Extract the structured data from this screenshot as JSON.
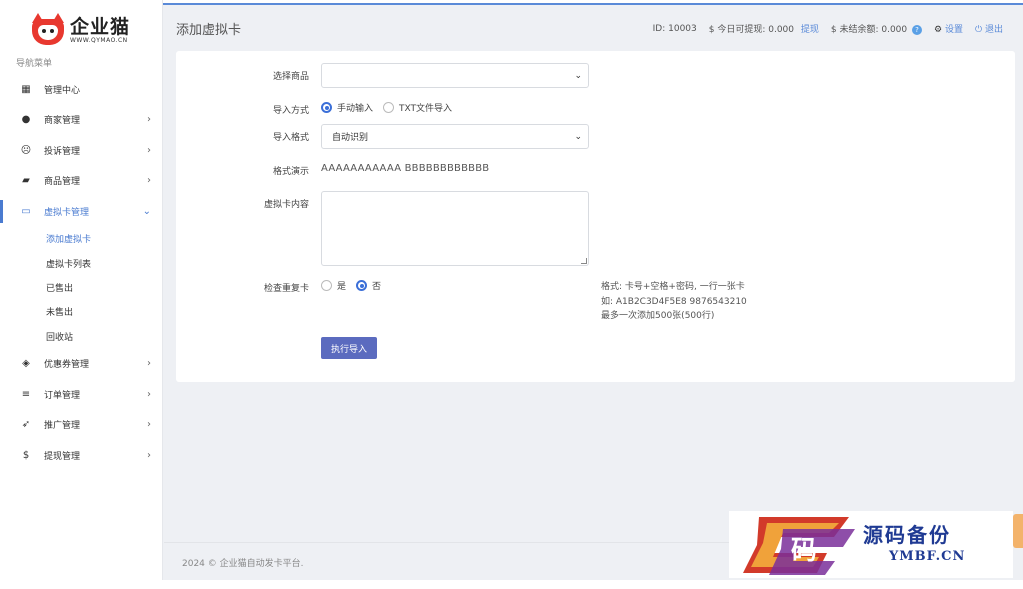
{
  "brand": {
    "name": "企业猫",
    "url_text": "WWW.QYMAO.CN"
  },
  "sidebar": {
    "title": "导航菜单",
    "items": [
      {
        "label": "管理中心",
        "icon": "dashboard-icon",
        "glyph": "▦",
        "chevron": ""
      },
      {
        "label": "商家管理",
        "icon": "user-icon",
        "glyph": "●",
        "chevron": "›"
      },
      {
        "label": "投诉管理",
        "icon": "sad-face-icon",
        "glyph": "☹",
        "chevron": "›"
      },
      {
        "label": "商品管理",
        "icon": "shopping-bag-icon",
        "glyph": "▰",
        "chevron": "›"
      },
      {
        "label": "虚拟卡管理",
        "icon": "credit-card-icon",
        "glyph": "▭",
        "chevron": "⌄"
      }
    ],
    "subitems": [
      "添加虚拟卡",
      "虚拟卡列表",
      "已售出",
      "未售出",
      "回收站"
    ],
    "items_after": [
      {
        "label": "优惠券管理",
        "icon": "ticket-icon",
        "glyph": "◈",
        "chevron": "›"
      },
      {
        "label": "订单管理",
        "icon": "list-icon",
        "glyph": "≡",
        "chevron": "›"
      },
      {
        "label": "推广管理",
        "icon": "paper-plane-icon",
        "glyph": "➶",
        "chevron": "›"
      },
      {
        "label": "提现管理",
        "icon": "dollar-icon",
        "glyph": "$",
        "chevron": "›"
      }
    ]
  },
  "header": {
    "title": "添加虚拟卡",
    "id_label": "ID: 10003",
    "withdraw_label": "$ 今日可提现: 0.000",
    "withdraw_link": "提现",
    "unsettled_label": "$ 未结余额: 0.000",
    "unsettled_help": "?",
    "settings": "设置",
    "logout": "退出"
  },
  "form": {
    "product_label": "选择商品",
    "product_value": "",
    "import_mode_label": "导入方式",
    "import_mode_manual": "手动输入",
    "import_mode_txt": "TXT文件导入",
    "import_format_label": "导入格式",
    "import_format_value": "自动识别",
    "format_demo_label": "格式演示",
    "format_demo_value": "AAAAAAAAAAA BBBBBBBBBBBB",
    "content_label": "虚拟卡内容",
    "content_value": "",
    "check_dup_label": "检查重复卡",
    "check_dup_yes": "是",
    "check_dup_no": "否",
    "hint_lines": [
      "格式: 卡号+空格+密码, 一行一张卡",
      "如: A1B2C3D4F5E8 9876543210",
      "最多一次添加500张(500行)"
    ],
    "submit": "执行导入"
  },
  "footer": {
    "copyright": "2024 © 企业猫自动发卡平台."
  },
  "watermark": {
    "text": "源码备份",
    "url": "YMBF.CN",
    "glyph": "码"
  }
}
